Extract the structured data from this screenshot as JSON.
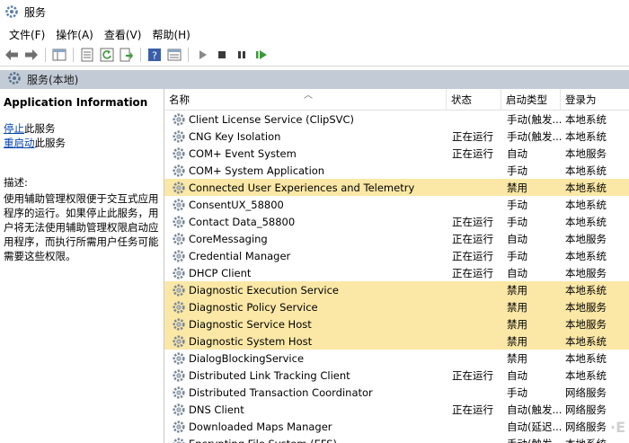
{
  "window": {
    "title": "服务"
  },
  "menu": [
    "文件(F)",
    "操作(A)",
    "查看(V)",
    "帮助(H)"
  ],
  "scope": {
    "label": "服务(本地)"
  },
  "left": {
    "heading": "Application Information",
    "stop_link": "停止",
    "stop_suffix": "此服务",
    "restart_link": "重启动",
    "restart_suffix": "此服务",
    "desc_label": "描述:",
    "description": "使用辅助管理权限便于交互式应用程序的运行。如果停止此服务，用户将无法使用辅助管理权限启动应用程序，而执行所需用户任务可能需要这些权限。"
  },
  "columns": {
    "name": "名称",
    "status": "状态",
    "startup": "启动类型",
    "logon": "登录为"
  },
  "services": [
    {
      "name": "Client License Service (ClipSVC)",
      "status": "",
      "startup": "手动(触发...",
      "logon": "本地系统",
      "highlight": false
    },
    {
      "name": "CNG Key Isolation",
      "status": "正在运行",
      "startup": "手动(触发...",
      "logon": "本地系统",
      "highlight": false
    },
    {
      "name": "COM+ Event System",
      "status": "正在运行",
      "startup": "自动",
      "logon": "本地服务",
      "highlight": false
    },
    {
      "name": "COM+ System Application",
      "status": "",
      "startup": "手动",
      "logon": "本地系统",
      "highlight": false
    },
    {
      "name": "Connected User Experiences and Telemetry",
      "status": "",
      "startup": "禁用",
      "logon": "本地系统",
      "highlight": true
    },
    {
      "name": "ConsentUX_58800",
      "status": "",
      "startup": "手动",
      "logon": "本地系统",
      "highlight": false
    },
    {
      "name": "Contact Data_58800",
      "status": "正在运行",
      "startup": "手动",
      "logon": "本地系统",
      "highlight": false
    },
    {
      "name": "CoreMessaging",
      "status": "正在运行",
      "startup": "自动",
      "logon": "本地服务",
      "highlight": false
    },
    {
      "name": "Credential Manager",
      "status": "正在运行",
      "startup": "手动",
      "logon": "本地系统",
      "highlight": false
    },
    {
      "name": "DHCP Client",
      "status": "正在运行",
      "startup": "自动",
      "logon": "本地服务",
      "highlight": false
    },
    {
      "name": "Diagnostic Execution Service",
      "status": "",
      "startup": "禁用",
      "logon": "本地系统",
      "highlight": true
    },
    {
      "name": "Diagnostic Policy Service",
      "status": "",
      "startup": "禁用",
      "logon": "本地服务",
      "highlight": true
    },
    {
      "name": "Diagnostic Service Host",
      "status": "",
      "startup": "禁用",
      "logon": "本地服务",
      "highlight": true
    },
    {
      "name": "Diagnostic System Host",
      "status": "",
      "startup": "禁用",
      "logon": "本地系统",
      "highlight": true
    },
    {
      "name": "DialogBlockingService",
      "status": "",
      "startup": "禁用",
      "logon": "本地系统",
      "highlight": false
    },
    {
      "name": "Distributed Link Tracking Client",
      "status": "正在运行",
      "startup": "自动",
      "logon": "本地系统",
      "highlight": false
    },
    {
      "name": "Distributed Transaction Coordinator",
      "status": "",
      "startup": "手动",
      "logon": "网络服务",
      "highlight": false
    },
    {
      "name": "DNS Client",
      "status": "正在运行",
      "startup": "自动(触发...",
      "logon": "网络服务",
      "highlight": false
    },
    {
      "name": "Downloaded Maps Manager",
      "status": "",
      "startup": "自动(延迟...",
      "logon": "网络服务",
      "highlight": false
    },
    {
      "name": "Encrypting File System (EFS)",
      "status": "",
      "startup": "手动(触发...",
      "logon": "本地系统",
      "highlight": false
    }
  ],
  "colors": {
    "highlight": "#fbe8a6",
    "scopebar": "#c2cbd6",
    "link": "#0645ad"
  },
  "icons": [
    "services-app-icon",
    "back-arrow-icon",
    "forward-arrow-icon",
    "console-tree-icon",
    "properties-icon",
    "refresh-icon",
    "export-list-icon",
    "help-icon",
    "details-view-icon",
    "play-icon",
    "stop-icon",
    "pause-icon",
    "resume-icon",
    "gear-icon"
  ]
}
